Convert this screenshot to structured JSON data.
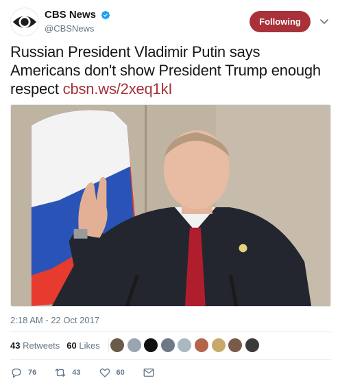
{
  "account": {
    "display_name": "CBS News",
    "handle": "@CBSNews",
    "verified": true,
    "avatar_icon": "cbs-eye-logo"
  },
  "follow_button": {
    "label": "Following",
    "color": "#a8313a"
  },
  "menu": {
    "icon": "chevron-down-icon"
  },
  "tweet": {
    "text": "Russian President Vladimir Putin says Americans don't show President Trump enough respect ",
    "link": "cbsn.ws/2xeq1kI",
    "link_color": "#a8313a"
  },
  "media": {
    "description_icon": "photo"
  },
  "timestamp": "2:18 AM - 22 Oct 2017",
  "stats": {
    "retweets_count": "43",
    "retweets_label": "Retweets",
    "likes_count": "60",
    "likes_label": "Likes"
  },
  "liker_avatars": [
    {
      "color": "#6b5a4a"
    },
    {
      "color": "#9aa5b1"
    },
    {
      "color": "#111111"
    },
    {
      "color": "#6d7a86"
    },
    {
      "color": "#aab8c2"
    },
    {
      "color": "#b5654a"
    },
    {
      "color": "#c9a86b"
    },
    {
      "color": "#7a5a48"
    },
    {
      "color": "#3a3a3a"
    }
  ],
  "actions": {
    "reply_count": "76",
    "retweet_count": "43",
    "like_count": "60"
  }
}
